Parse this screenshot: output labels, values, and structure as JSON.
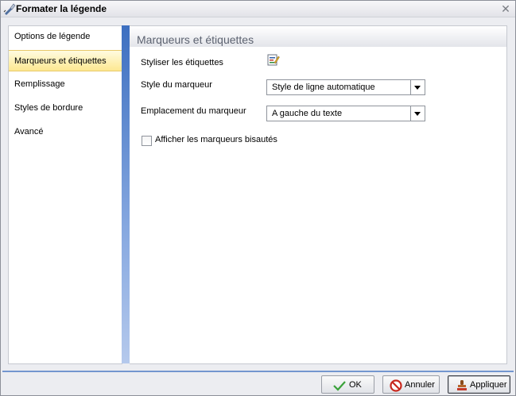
{
  "window": {
    "title": "Formater la légende"
  },
  "sidebar": {
    "items": [
      {
        "label": "Options de légende"
      },
      {
        "label": "Marqueurs et étiquettes",
        "selected": true
      },
      {
        "label": "Remplissage"
      },
      {
        "label": "Styles de bordure"
      },
      {
        "label": "Avancé"
      }
    ]
  },
  "main": {
    "section_title": "Marqueurs et étiquettes",
    "stylize_label": "Styliser les étiquettes",
    "marker_style": {
      "label": "Style du marqueur",
      "value": "Style de ligne automatique"
    },
    "marker_position": {
      "label": "Emplacement du marqueur",
      "value": "A gauche du texte"
    },
    "beveled": {
      "label": "Afficher les marqueurs bisautés",
      "checked": false
    }
  },
  "footer": {
    "ok_label": "OK",
    "cancel_label": "Annuler",
    "apply_label": "Appliquer"
  },
  "colors": {
    "accent": "#3d6fc0",
    "selection": "#fde891",
    "footer_line": "#7396cf"
  }
}
